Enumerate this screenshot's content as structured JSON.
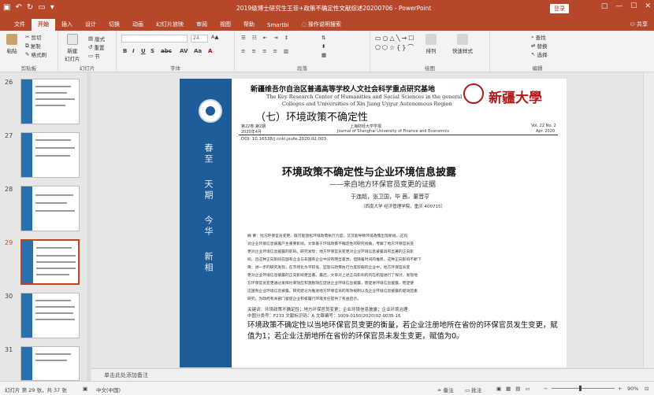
{
  "titlebar": {
    "title": "2019级博士研究生王菲+政策不确定性文献综述20200706 - PowerPoint",
    "login_label": "登录",
    "colors": {
      "accent": "#b7472a"
    }
  },
  "tabs": [
    "文件",
    "开始",
    "插入",
    "设计",
    "切换",
    "动画",
    "幻灯片放映",
    "审阅",
    "视图",
    "帮助",
    "Smartbi",
    "操作说明搜索"
  ],
  "share_label": "共享",
  "ribbon": {
    "clipboard": {
      "paste": "粘贴",
      "cut": "剪切",
      "copy": "复制",
      "format_painter": "格式刷",
      "label": "剪贴板"
    },
    "slides": {
      "new_slide": "新建\n幻灯片",
      "layout": "版式",
      "reset": "重置",
      "section": "节",
      "label": "幻灯片"
    },
    "font": {
      "size": "24",
      "label": "字体"
    },
    "paragraph": {
      "label": "段落"
    },
    "drawing": {
      "arrange": "排列",
      "quick_styles": "快速样式",
      "label": "绘图"
    },
    "editing": {
      "find": "查找",
      "replace": "替换",
      "select": "选择",
      "label": "编辑"
    }
  },
  "thumbnails": [
    {
      "num": "26"
    },
    {
      "num": "27"
    },
    {
      "num": "28"
    },
    {
      "num": "29"
    },
    {
      "num": "30"
    },
    {
      "num": "31"
    }
  ],
  "slide": {
    "header_cn": "新疆维吾尔自治区普通高等学校人文社会科学重点研究基地",
    "header_en1": "The Key Research Center of Humanities and Social Sciences in the general",
    "header_en2": "Colleges and Universities of Xin Jiang Uygur Autonomous Region",
    "university_logo": "新疆大學",
    "section_title": "（七）环境政策不确定性",
    "vol_left": "第22卷 第2期",
    "date_left": "2020年4月",
    "journal_cn": "上海财经大学学报",
    "journal_en": "Journal of Shanghai University of Finance and Economics",
    "vol_right": "Vol. 22 No. 2",
    "date_right": "Apr. 2020",
    "doi": "DOI: 10.16538/j.cnki.jsufe.2020.02.003",
    "paper_title": "环境政策不确定性与企业环境信息披露",
    "paper_subtitle": "——来自地方环保官员变更的证据",
    "authors": "于连超，张卫国，毕 茜，董晋亨",
    "affiliation": "（西南大学 经济管理学院，重庆 400715）",
    "calligraphy": [
      "春",
      "至",
      "天",
      "期",
      "今",
      "华",
      "新",
      "相"
    ],
    "abstract_lines": [
      "摘  要：地方环保官员变更，既可能放松环境政策执行力度，又可能导致环境政策出现新规，这均",
      "对企业环境信息披露产生重要影响。文章基于环境政策不确定性的研究视角，考察了地方环保官员变",
      "更对企业环境信息披露的影响。研究发现：地方环保官员变更对企业环境信息披露具有显著的正向影",
      "响，且这种正向影响在国有企业与非国有企业中没有明显差异，但随着时间的推移，这种正向影响不断下",
      "降；进一步的研究发现，在市场化水平较低、监管与政策执行力度较弱的企业中，地方环保官员变",
      "更对企业环境信息披露的正向影响更显著。最后，文章对上述正向影响的内在机理进行了探讨，发现地",
      "方环保官员变更通过发挥约束效应和激励效应促进企业环境信息披露，而促进环境信息披露，而促使",
      "这国有企业环境信息披露。研究结论为推进地方环保官员的有效规制以及企业环境信息披露的驱动因素",
      "研究，为政府有关部门督促企业积极履行环境责任提供了有益启示。"
    ],
    "keywords": "关键词：环境政策不确定性；地方环保官员变更；企业环境信息披露；企业环境治理",
    "classification": "中图分类号：F233    文献标识码：A    文章编号：1009-0150(2020)02-0035-16",
    "body_text": "环境政策不确定性以当地环保官员变更的衡量，若企业注册地所在省份的环保官员发生变更，赋值为1；若企业注册地所在省份的环保官员未发生变更，赋值为0。"
  },
  "notes_placeholder": "单击此处添加备注",
  "status": {
    "slide_pos": "幻灯片 第 29 张，共 37 张",
    "language": "中文(中国)",
    "notes": "备注",
    "comments": "批注",
    "zoom": "90%"
  }
}
